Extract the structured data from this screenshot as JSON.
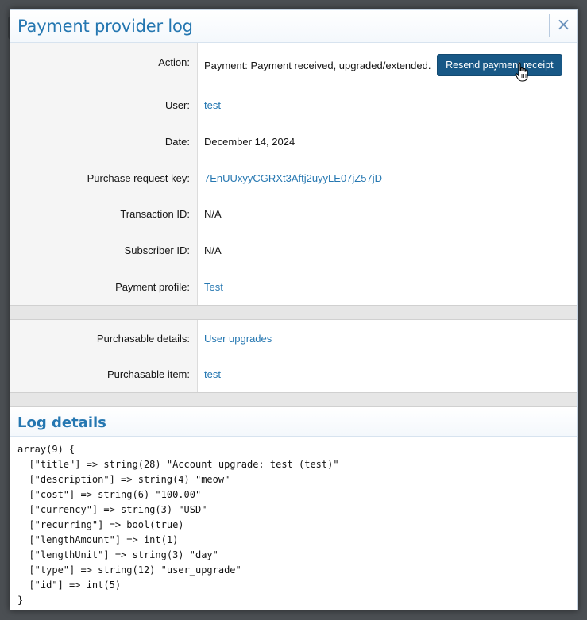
{
  "dialog": {
    "title": "Payment provider log",
    "close_icon": "×"
  },
  "fields": [
    {
      "label": "Action:",
      "value": "Payment: Payment received, upgraded/extended.",
      "is_link": false
    },
    {
      "label": "User:",
      "value": "test",
      "is_link": true
    },
    {
      "label": "Date:",
      "value": "December 14, 2024",
      "is_link": false
    },
    {
      "label": "Purchase request key:",
      "value": "7EnUUxyyCGRXt3Aftj2uyyLE07jZ57jD",
      "is_link": true
    },
    {
      "label": "Transaction ID:",
      "value": "N/A",
      "is_link": false
    },
    {
      "label": "Subscriber ID:",
      "value": "N/A",
      "is_link": false
    },
    {
      "label": "Payment profile:",
      "value": "Test",
      "is_link": true
    }
  ],
  "purchasable": [
    {
      "label": "Purchasable details:",
      "value": "User upgrades",
      "is_link": true
    },
    {
      "label": "Purchasable item:",
      "value": "test",
      "is_link": true
    }
  ],
  "action_button": {
    "label": "Resend payment receipt"
  },
  "log": {
    "title": "Log details",
    "lines": [
      "array(9) {",
      "  [\"title\"] => string(28) \"Account upgrade: test (test)\"",
      "  [\"description\"] => string(4) \"meow\"",
      "  [\"cost\"] => string(6) \"100.00\"",
      "  [\"currency\"] => string(3) \"USD\"",
      "  [\"recurring\"] => bool(true)",
      "  [\"lengthAmount\"] => int(1)",
      "  [\"lengthUnit\"] => string(3) \"day\"",
      "  [\"type\"] => string(12) \"user_upgrade\"",
      "  [\"id\"] => int(5)",
      "}"
    ]
  },
  "colors": {
    "accent": "#2577b1",
    "button": "#185886"
  }
}
